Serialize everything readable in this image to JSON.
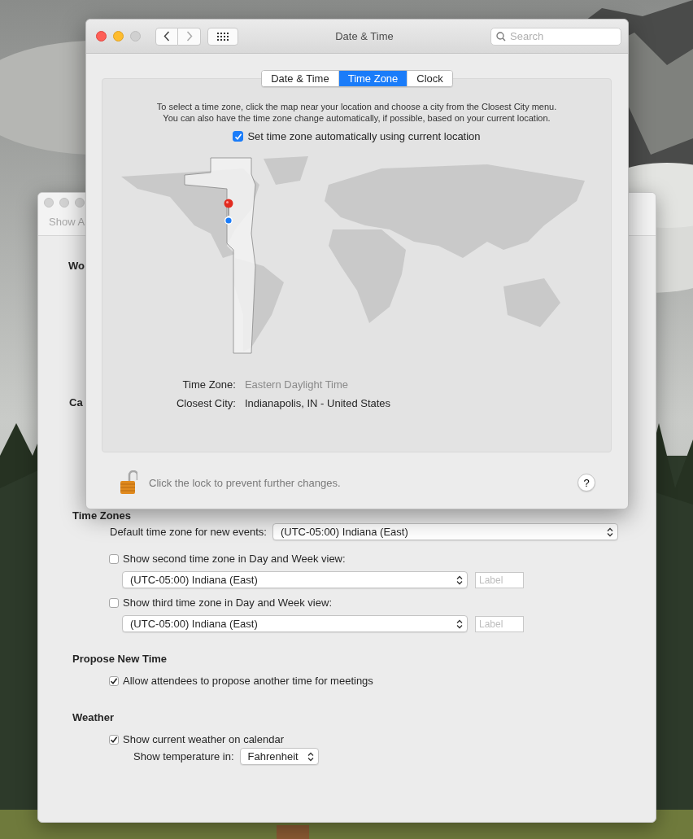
{
  "calendar_window": {
    "active": false,
    "toolbar_label": "Show A",
    "cut_headings": [
      "Wo",
      "Ca"
    ],
    "time_zones": {
      "heading": "Time Zones",
      "default_label": "Default time zone for new events:",
      "default_value": "(UTC-05:00) Indiana (East)",
      "extra": [
        {
          "label": "Show second time zone in Day and Week view:",
          "checked": false,
          "value": "(UTC-05:00) Indiana (East)",
          "placeholder": "Label"
        },
        {
          "label": "Show third time zone in Day and Week view:",
          "checked": false,
          "value": "(UTC-05:00) Indiana (East)",
          "placeholder": "Label"
        }
      ]
    },
    "propose": {
      "heading": "Propose New Time",
      "options": [
        {
          "label": "Allow attendees to propose another time for meetings",
          "checked": true
        }
      ]
    },
    "weather": {
      "heading": "Weather",
      "show": {
        "label": "Show current weather on calendar",
        "checked": true
      },
      "temp_label": "Show temperature in:",
      "temp_value": "Fahrenheit"
    }
  },
  "prefs_window": {
    "active": true,
    "title": "Date & Time",
    "search_placeholder": "Search",
    "tabs": [
      {
        "label": "Date & Time",
        "selected": false
      },
      {
        "label": "Time Zone",
        "selected": true
      },
      {
        "label": "Clock",
        "selected": false
      }
    ],
    "instructions": [
      "To select a time zone, click the map near your location and choose a city from the Closest City menu.",
      "You can also have the time zone change automatically, if possible, based on your current location."
    ],
    "auto": {
      "label": "Set time zone automatically using current location",
      "checked": true
    },
    "info": [
      {
        "label": "Time Zone:",
        "value": "Eastern Daylight Time",
        "dimmed": true
      },
      {
        "label": "Closest City:",
        "value": "Indianapolis, IN - United States",
        "dimmed": false
      }
    ],
    "lock_text": "Click the lock to prevent further changes.",
    "help": "?"
  }
}
